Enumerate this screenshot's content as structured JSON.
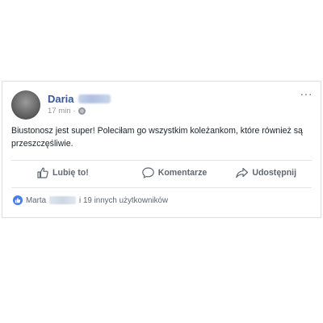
{
  "post": {
    "author": "Daria",
    "time": "17 min",
    "separator": "·",
    "privacy_icon": "globe-icon",
    "menu": "···",
    "text": "Biustonosz jest super! Poleciłam go wszystkim koleżankom, które również są przeszczęśliwie."
  },
  "actions": {
    "like_label": "Lubię to!",
    "comment_label": "Komentarze",
    "share_label": "Udostępnij"
  },
  "reactions": {
    "first_name": "Marta",
    "others_text": "i 19 innych użytkowników"
  },
  "colors": {
    "link_blue": "#365899",
    "like_blue": "#4a7ce8",
    "muted_gray": "#606770",
    "border": "#dddfe2"
  }
}
